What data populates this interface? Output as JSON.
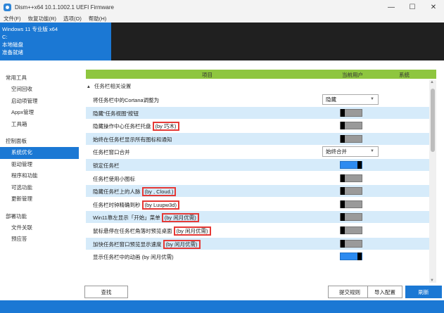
{
  "window": {
    "title": "Dism++x64 10.1.1002.1 UEFI Firmware",
    "minimize": "—",
    "maximize": "☐",
    "close": "✕"
  },
  "menu": [
    "文件(F)",
    "恢复功能(R)",
    "选项(O)",
    "帮助(H)"
  ],
  "system_info": {
    "os": "Windows 11 专业版 x64",
    "drive": "C:",
    "disk": "本地磁盘",
    "status": "准备就绪"
  },
  "sidebar": {
    "groups": [
      {
        "label": "常用工具",
        "items": [
          "空间回收",
          "启动项管理",
          "Appx管理",
          "工具箱"
        ]
      },
      {
        "label": "控制面板",
        "items": [
          "系统优化",
          "驱动管理",
          "程序和功能",
          "可选功能",
          "更新管理"
        ]
      },
      {
        "label": "部署功能",
        "items": [
          "文件关联",
          "预应答"
        ]
      }
    ],
    "active": "系统优化"
  },
  "table": {
    "headers": {
      "item": "项目",
      "user": "当前用户",
      "system": "系统"
    },
    "section": "任务栏相关设置",
    "section_icon": "chevron-down-icon",
    "rows": [
      {
        "label": "将任务栏中的Cortana调整为",
        "annotation": "",
        "control": "select",
        "value": "隐藏"
      },
      {
        "label": "隐藏“任务视图”按钮",
        "annotation": "",
        "control": "toggle",
        "on": false
      },
      {
        "label": "隐藏操作中心任务栏托盘",
        "annotation": "(by 巧木)",
        "control": "toggle",
        "on": false
      },
      {
        "label": "始终在任务栏显示所有图标和通知",
        "annotation": "",
        "control": "toggle",
        "on": false
      },
      {
        "label": "任务栏窗口合并",
        "annotation": "",
        "control": "select",
        "value": "始终合并"
      },
      {
        "label": "锁定任务栏",
        "annotation": "",
        "control": "toggle",
        "on": true
      },
      {
        "label": "任务栏使用小图标",
        "annotation": "",
        "control": "toggle",
        "on": false
      },
      {
        "label": "隐藏任务栏上的人脉",
        "annotation": "(by , Cloud.)",
        "control": "toggle",
        "on": false
      },
      {
        "label": "任务栏时钟精确到秒",
        "annotation": "(by Luupw3d)",
        "control": "toggle",
        "on": false
      },
      {
        "label": "Win11靠左显示「开始」菜单",
        "annotation": "(by 闲月优需)",
        "control": "toggle",
        "on": false
      },
      {
        "label": "鼠标悬停在任务栏角落时预览桌面",
        "annotation": "(by 闲月优需)",
        "control": "toggle",
        "on": false
      },
      {
        "label": "加快任务栏窗口预览显示速度",
        "annotation": "(by 闲月优需)",
        "control": "toggle",
        "on": false
      },
      {
        "label": "显示任务栏中的动画 (by 闲月优需)",
        "annotation": "",
        "control": "toggle",
        "on": true
      }
    ]
  },
  "buttons": {
    "search": "查找",
    "submit_rule": "提交规则",
    "import_config": "导入配置",
    "refresh": "刷新"
  },
  "colors": {
    "accent": "#1b78d4",
    "header_bg": "#8ec63f",
    "alt_row": "#d6ebfa",
    "highlight": "#e53935"
  }
}
